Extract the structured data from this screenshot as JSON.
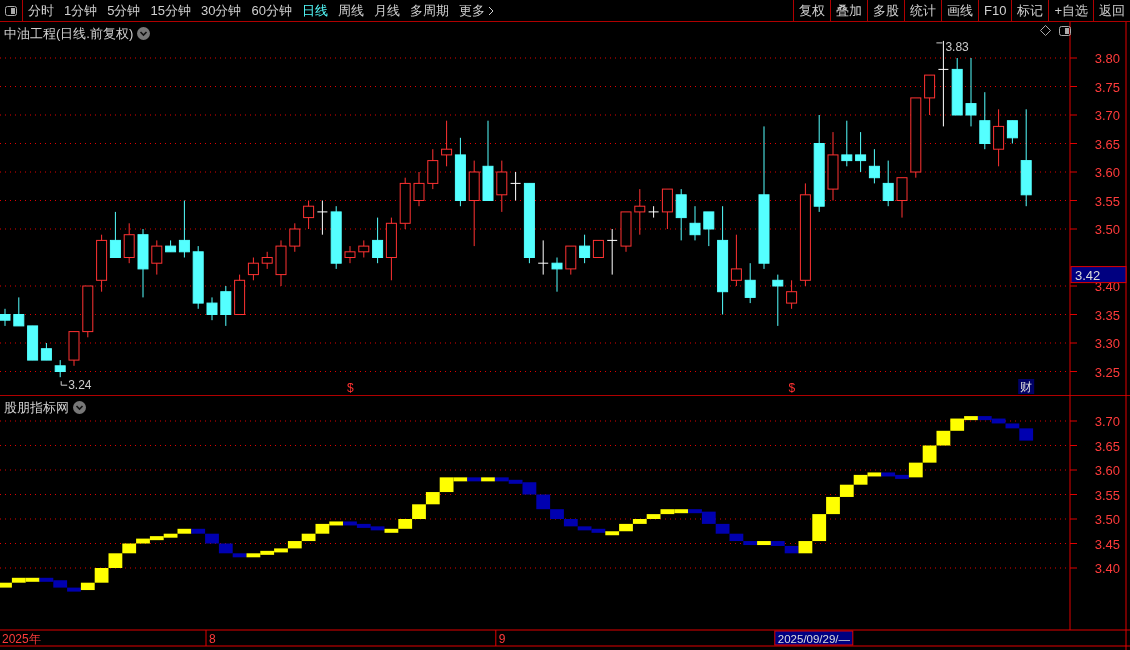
{
  "toolbar": {
    "periods": [
      {
        "label": "分时",
        "selected": false
      },
      {
        "label": "1分钟",
        "selected": false
      },
      {
        "label": "5分钟",
        "selected": false
      },
      {
        "label": "15分钟",
        "selected": false
      },
      {
        "label": "30分钟",
        "selected": false
      },
      {
        "label": "60分钟",
        "selected": false
      },
      {
        "label": "日线",
        "selected": true
      },
      {
        "label": "周线",
        "selected": false
      },
      {
        "label": "月线",
        "selected": false
      },
      {
        "label": "多周期",
        "selected": false
      },
      {
        "label": "更多",
        "selected": false
      }
    ],
    "buttons": [
      "复权",
      "叠加",
      "多股",
      "统计",
      "画线",
      "F10",
      "标记",
      "+自选",
      "返回"
    ]
  },
  "price_chart": {
    "title": "中油工程(日线.前复权)",
    "current_price": "3.42",
    "high_label": "3.83",
    "low_label": "3.24",
    "axis_labels": [
      "3.80",
      "3.75",
      "3.70",
      "3.65",
      "3.60",
      "3.55",
      "3.50",
      "3.40",
      "3.35",
      "3.30",
      "3.25"
    ],
    "markers": [
      {
        "kind": "event",
        "text": "$"
      },
      {
        "kind": "event",
        "text": "$"
      },
      {
        "kind": "finance",
        "text": "财"
      }
    ]
  },
  "indicator_chart": {
    "title": "股朋指标网",
    "axis_labels": [
      "3.70",
      "3.65",
      "3.60",
      "3.55",
      "3.50",
      "3.45",
      "3.40"
    ],
    "time_labels": [
      "2025年",
      "8",
      "9"
    ],
    "cursor_label": "2025/09/29/—"
  }
}
